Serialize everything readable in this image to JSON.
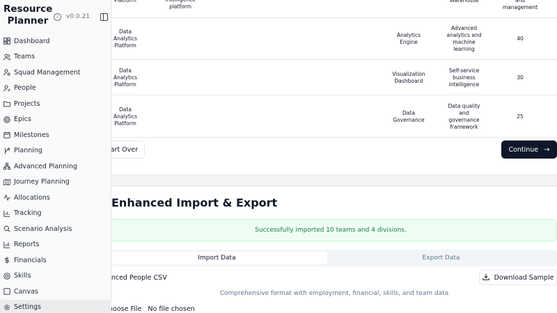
{
  "sidebar": {
    "brand_line1": "Resource",
    "brand_line2": "Planner",
    "version": "v0.0.21",
    "items": [
      {
        "label": "Dashboard",
        "icon": "dashboard-icon"
      },
      {
        "label": "Teams",
        "icon": "users-icon"
      },
      {
        "label": "Squad Management",
        "icon": "user-cog-icon"
      },
      {
        "label": "People",
        "icon": "user-check-icon"
      },
      {
        "label": "Projects",
        "icon": "folder-icon"
      },
      {
        "label": "Epics",
        "icon": "target-icon"
      },
      {
        "label": "Milestones",
        "icon": "calendar-icon"
      },
      {
        "label": "Planning",
        "icon": "git-branch-icon"
      },
      {
        "label": "Advanced Planning",
        "icon": "network-icon"
      },
      {
        "label": "Journey Planning",
        "icon": "map-icon"
      },
      {
        "label": "Allocations",
        "icon": "activity-icon"
      },
      {
        "label": "Tracking",
        "icon": "bar-chart-icon"
      },
      {
        "label": "Scenario Analysis",
        "icon": "search-icon"
      },
      {
        "label": "Reports",
        "icon": "chart-icon"
      },
      {
        "label": "Financials",
        "icon": "dollar-icon"
      },
      {
        "label": "Skills",
        "icon": "award-icon"
      },
      {
        "label": "Canvas",
        "icon": "canvas-icon"
      },
      {
        "label": "Settings",
        "icon": "gear-icon"
      }
    ]
  },
  "table": {
    "partial_row": {
      "team": "Platform",
      "description": "intelligence platform",
      "descr2": "Warehouse",
      "capacity": "and management"
    },
    "rows": [
      {
        "team": "Data Analytics Platform",
        "name": "Analytics Engine",
        "description": "Advanced analytics and machine learning",
        "capacity": "40"
      },
      {
        "team": "Data Analytics Platform",
        "name": "Visualization Dashboard",
        "description": "Self-service business intelligence",
        "capacity": "30"
      },
      {
        "team": "Data Analytics Platform",
        "name": "Data Governance",
        "description": "Data quality and governance framework",
        "capacity": "25"
      }
    ]
  },
  "actions": {
    "start_over": "tart Over",
    "continue": "Continue",
    "continue_arrow": "→"
  },
  "import_export": {
    "title": "Enhanced Import & Export",
    "success_message": "Successfully imported 10 teams and 4 divisions.",
    "tab_import": "Import Data",
    "tab_export": "Export Data",
    "csv_title": "anced People CSV",
    "download_label": "Download Sample",
    "csv_description": "Comprehensive format with employment, financial, skills, and team data",
    "choose_file": "hoose File",
    "no_file": "No file chosen"
  }
}
